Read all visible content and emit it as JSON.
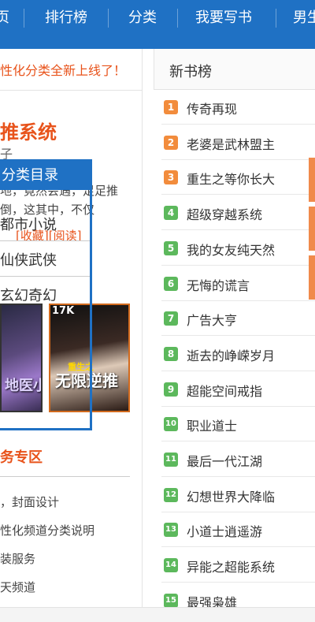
{
  "nav": {
    "items": [
      {
        "label": "页"
      },
      {
        "label": "排行榜"
      },
      {
        "label": "分类"
      },
      {
        "label": "我要写书"
      },
      {
        "label": "男生"
      }
    ]
  },
  "left": {
    "notice": "性化分类全新上线了！",
    "feature": {
      "title": "推系统",
      "subtitle": "子",
      "desc": "地，竟然会遇，足足推倒，这其中，不仅",
      "collect": "[收藏]",
      "read": "[阅读]"
    },
    "dropdown": {
      "header": "分类目录",
      "items": [
        {
          "label": "都市小说"
        },
        {
          "label": "仙侠武侠"
        },
        {
          "label": "玄幻奇幻"
        }
      ]
    },
    "covers": [
      {
        "title": "地医小都市",
        "logo": ""
      },
      {
        "title": "无限逆推",
        "subtitle": "重生之",
        "logo": "17K"
      }
    ],
    "service": {
      "title": "务专区",
      "items": [
        {
          "label": "，封面设计"
        },
        {
          "label": "性化频道分类说明"
        },
        {
          "label": "装服务"
        },
        {
          "label": "天频道"
        }
      ]
    }
  },
  "right": {
    "title": "新书榜",
    "rank_colors": {
      "top": "#f28c3c",
      "rest": "#5cb85c"
    },
    "ranks": [
      {
        "num": "1",
        "name": "传奇再现"
      },
      {
        "num": "2",
        "name": "老婆是武林盟主"
      },
      {
        "num": "3",
        "name": "重生之等你长大"
      },
      {
        "num": "4",
        "name": "超级穿越系统"
      },
      {
        "num": "5",
        "name": "我的女友纯天然"
      },
      {
        "num": "6",
        "name": "无悔的谎言"
      },
      {
        "num": "7",
        "name": "广告大亨"
      },
      {
        "num": "8",
        "name": "逝去的峥嵘岁月"
      },
      {
        "num": "9",
        "name": "超能空间戒指"
      },
      {
        "num": "10",
        "name": "职业道士"
      },
      {
        "num": "11",
        "name": "最后一代江湖"
      },
      {
        "num": "12",
        "name": "幻想世界大降临"
      },
      {
        "num": "13",
        "name": "小道士逍遥游"
      },
      {
        "num": "14",
        "name": "异能之超能系统"
      },
      {
        "num": "15",
        "name": "最强枭雄"
      }
    ]
  },
  "colors": {
    "brand": "#1f71c4",
    "accent": "#e8531b"
  }
}
